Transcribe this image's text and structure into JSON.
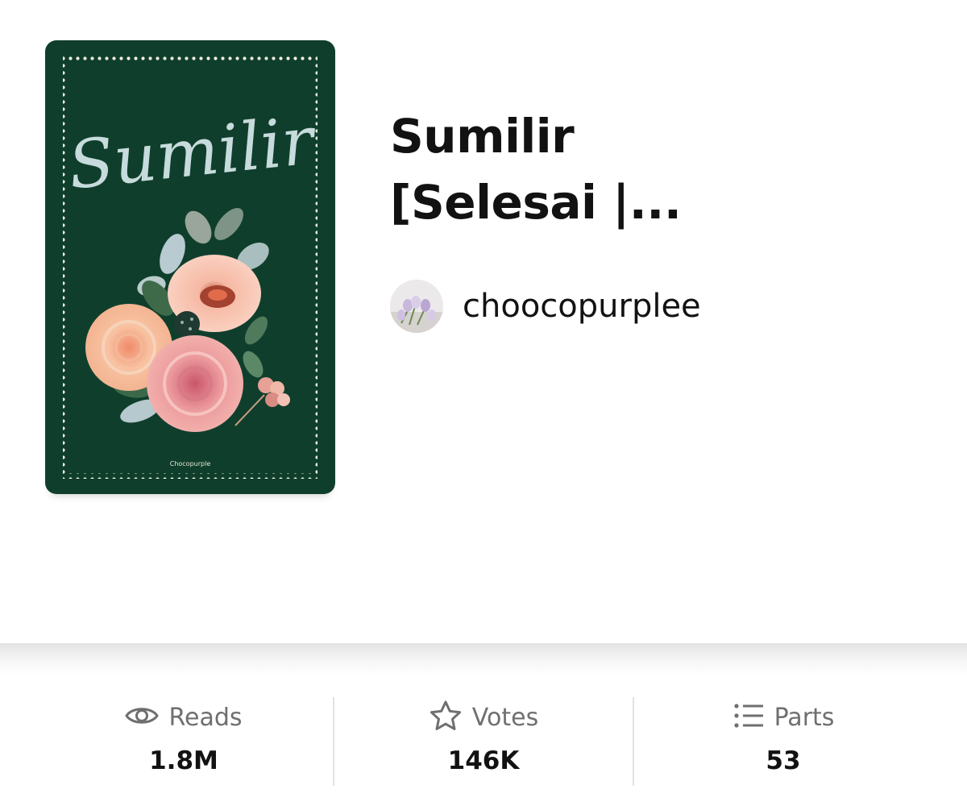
{
  "story": {
    "title_line1": "Sumilir",
    "title_line2": "[Selesai |...",
    "cover": {
      "script_title": "Sumilir",
      "signature": "Chocopurple",
      "background_color": "#0f3f2c"
    },
    "author": {
      "name": "choocopurplee"
    }
  },
  "stats": {
    "reads": {
      "icon": "eye-icon",
      "label": "Reads",
      "value": "1.8M"
    },
    "votes": {
      "icon": "star-icon",
      "label": "Votes",
      "value": "146K"
    },
    "parts": {
      "icon": "list-icon",
      "label": "Parts",
      "value": "53"
    }
  }
}
